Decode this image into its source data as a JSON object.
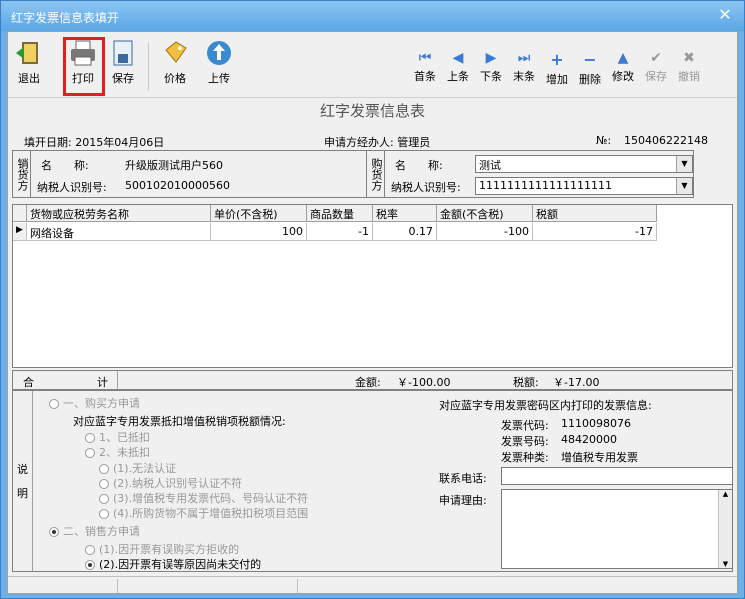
{
  "window": {
    "title": "红字发票信息表填开",
    "close": "✕"
  },
  "toolbar": {
    "exit": "退出",
    "print": "打印",
    "save": "保存",
    "price": "价格",
    "upload": "上传",
    "first": "首条",
    "prev": "上条",
    "next": "下条",
    "last": "末条",
    "add": "增加",
    "delete": "删除",
    "modify": "修改",
    "save2": "保存",
    "cancel": "撤销"
  },
  "form": {
    "title": "红字发票信息表",
    "fill_date": "填开日期: 2015年04月06日",
    "applicant": "申请方经办人: 管理员",
    "no_label": "№:",
    "no_value": "150406222148"
  },
  "seller": {
    "side_label": "销货方",
    "name_label": "名　　称:",
    "name_value": "升级版测试用户560",
    "tax_label": "纳税人识别号:",
    "tax_value": "500102010000560"
  },
  "buyer": {
    "side_label": "购货方",
    "name_label": "名　　称:",
    "name_value": "测试",
    "tax_label": "纳税人识别号:",
    "tax_value": "1111111111111111111"
  },
  "table": {
    "headers": [
      "货物或应税劳务名称",
      "单价(不含税)",
      "商品数量",
      "税率",
      "金额(不含税)",
      "税额"
    ],
    "rows": [
      [
        "网络设备",
        "100",
        "-1",
        "0.17",
        "-100",
        "-17"
      ]
    ],
    "row_marker": "▶"
  },
  "totals": {
    "label1": "合",
    "label2": "计",
    "amount_label": "金额:",
    "amount_value": "￥-100.00",
    "tax_label": "税额:",
    "tax_value": "￥-17.00"
  },
  "notes": {
    "side_label1": "说",
    "side_label2": "明",
    "buyer_apply": "一、购买方申请",
    "deduct_question": "对应蓝字专用发票抵扣增值税销项税额情况:",
    "opt_deducted": "1、已抵扣",
    "opt_not_deducted": "2、未抵扣",
    "sub1": "(1).无法认证",
    "sub2": "(2).纳税人识别号认证不符",
    "sub3": "(3).增值税专用发票代码、号码认证不符",
    "sub4": "(4).所购货物不属于增值税扣税项目范围",
    "seller_apply": "二、销售方申请",
    "s1": "(1).因开票有误购买方拒收的",
    "s2": "(2).因开票有误等原因尚未交付的",
    "right_title": "对应蓝字专用发票密码区内打印的发票信息:",
    "code_label": "发票代码:",
    "code_value": "1110098076",
    "num_label": "发票号码:",
    "num_value": "48420000",
    "type_label": "发票种类:",
    "type_value": "增值税专用发票",
    "phone_label": "联系电话:",
    "reason_label": "申请理由:",
    "phone_value": "",
    "reason_value": ""
  },
  "colors": {
    "highlight": "#e02020",
    "titlebar": "#5aa6e6"
  }
}
